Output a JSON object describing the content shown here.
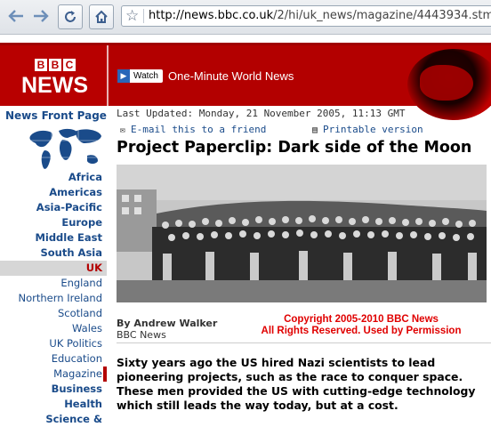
{
  "browser": {
    "url_host": "http://news.bbc.co.uk",
    "url_path": "/2/hi/uk_news/magazine/4443934.stm",
    "icons": [
      "back-arrow-icon",
      "forward-arrow-icon",
      "reload-icon",
      "home-icon",
      "bookmark-star-icon"
    ]
  },
  "masthead": {
    "logo_letters": [
      "B",
      "B",
      "C"
    ],
    "logo_word": "NEWS",
    "watch_label": "Watch",
    "watch_title": "One-Minute World News"
  },
  "leftnav": {
    "front_page": "News Front Page",
    "items": [
      {
        "label": "Africa",
        "style": "b"
      },
      {
        "label": "Americas",
        "style": "b"
      },
      {
        "label": "Asia-Pacific",
        "style": "b"
      },
      {
        "label": "Europe",
        "style": "b"
      },
      {
        "label": "Middle East",
        "style": "b"
      },
      {
        "label": "South Asia",
        "style": "b"
      },
      {
        "label": "UK",
        "style": "sel"
      },
      {
        "label": "England",
        "style": ""
      },
      {
        "label": "Northern Ireland",
        "style": ""
      },
      {
        "label": "Scotland",
        "style": ""
      },
      {
        "label": "Wales",
        "style": ""
      },
      {
        "label": "UK Politics",
        "style": ""
      },
      {
        "label": "Education",
        "style": ""
      },
      {
        "label": "Magazine",
        "style": "cur"
      },
      {
        "label": "Business",
        "style": "b"
      },
      {
        "label": "Health",
        "style": "b"
      },
      {
        "label": "Science &",
        "style": "b"
      }
    ]
  },
  "article": {
    "last_updated": "Last Updated: Monday, 21 November 2005, 11:13 GMT",
    "email_label": "E-mail this to a friend",
    "print_label": "Printable version",
    "headline": "Project Paperclip: Dark side of the Moon",
    "author": "By Andrew Walker",
    "source": "BBC News",
    "copyright_line1": "Copyright 2005-2010 BBC News",
    "copyright_line2": "All Rights Reserved. Used by Permission",
    "intro": "Sixty years ago the US hired Nazi scientists to lead pioneering projects, such as the race to conquer space. These men provided the US with cutting-edge technology which still leads the way today, but at a cost."
  },
  "colors": {
    "bbc_red": "#b30000",
    "nav_blue": "#1a4b8a",
    "copyright_red": "#e00000"
  }
}
